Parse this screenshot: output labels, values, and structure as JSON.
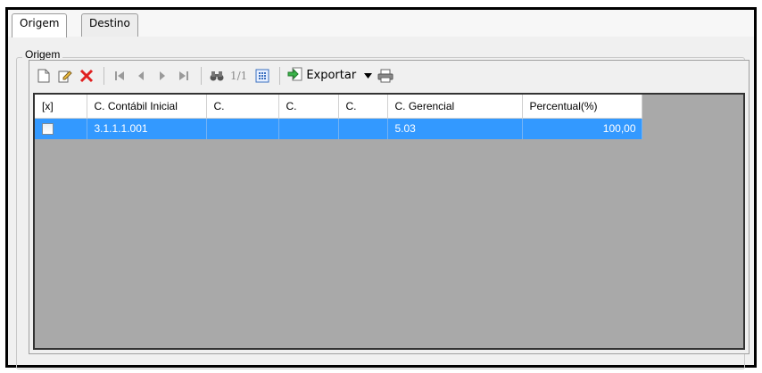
{
  "tabs": [
    {
      "label": "Origem",
      "active": true
    },
    {
      "label": "Destino",
      "active": false
    }
  ],
  "group": {
    "title": "Origem"
  },
  "toolbar": {
    "page_info": "1/1",
    "export_label": "Exportar"
  },
  "icons": {
    "new": "new-document-icon",
    "edit": "edit-icon",
    "delete": "delete-icon",
    "first": "first-page-icon",
    "prev": "previous-icon",
    "next": "next-icon",
    "last": "last-page-icon",
    "find": "binoculars-icon",
    "columns": "columns-grid-icon",
    "export": "export-icon",
    "dropdown": "chevron-down-icon",
    "print": "print-icon"
  },
  "grid": {
    "columns": [
      "[x]",
      "C. Contábil Inicial",
      "C.",
      "C.",
      "C.",
      "C. Gerencial",
      "Percentual(%)"
    ],
    "rows": [
      {
        "checked": false,
        "conta_contabil_inicial": "3.1.1.1.001",
        "c1": "",
        "c2": "",
        "c3": "",
        "conta_gerencial": "5.03",
        "percentual": "100,00"
      }
    ]
  },
  "colors": {
    "selection": "#3399ff",
    "grid_background": "#a9a9a9",
    "delete_red": "#e02020",
    "panel_background": "#f0f0f0"
  }
}
